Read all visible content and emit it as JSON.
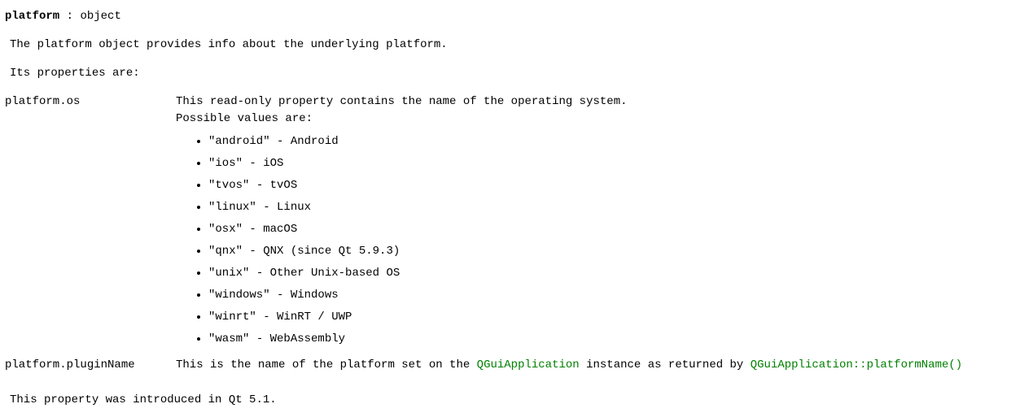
{
  "header": {
    "name": "platform",
    "colon": " : ",
    "type": "object"
  },
  "intro": {
    "prefix": "The ",
    "code": "platform",
    "suffix": " object provides info about the underlying platform."
  },
  "propertiesLabel": "Its properties are:",
  "props": {
    "os": {
      "name": "platform.os",
      "desc1": "This read-only property contains the name of the operating system.",
      "desc2": "Possible values are:",
      "values": [
        {
          "code": "\"android\"",
          "label": " - Android"
        },
        {
          "code": "\"ios\"",
          "label": " - iOS"
        },
        {
          "code": "\"tvos\"",
          "label": " - tvOS"
        },
        {
          "code": "\"linux\"",
          "label": " - Linux"
        },
        {
          "code": "\"osx\"",
          "label": " - macOS"
        },
        {
          "code": "\"qnx\"",
          "label": " - QNX (since Qt 5.9.3)"
        },
        {
          "code": "\"unix\"",
          "label": " - Other Unix-based OS"
        },
        {
          "code": "\"windows\"",
          "label": " - Windows"
        },
        {
          "code": "\"winrt\"",
          "label": " - WinRT / UWP"
        },
        {
          "code": "\"wasm\"",
          "label": " - WebAssembly"
        }
      ]
    },
    "pluginName": {
      "name": "platform.pluginName",
      "prefix": "This is the name of the platform set on the ",
      "link1": "QGuiApplication",
      "mid": " instance as returned by ",
      "link2": "QGuiApplication::platformName()"
    }
  },
  "footer": "This property was introduced in Qt 5.1."
}
